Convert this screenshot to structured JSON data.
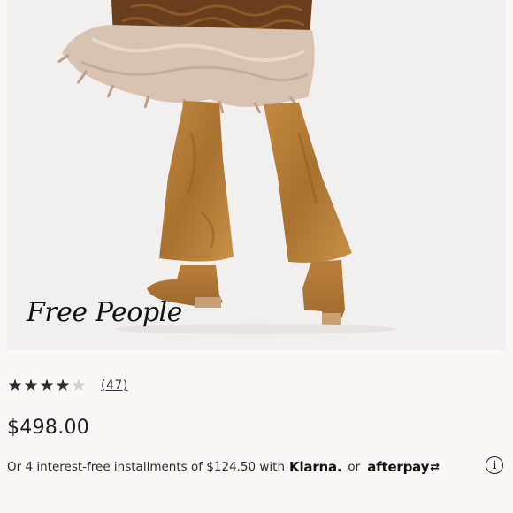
{
  "product": {
    "brand_watermark": "Free People",
    "rating": {
      "value": 4,
      "max": 5,
      "review_count_label": "(47)"
    },
    "price": "$498.00",
    "installments": {
      "prefix": "Or 4 interest-free installments of $124.50 with",
      "klarna_label": "Klarna.",
      "or_label": "or",
      "afterpay_label": "afterpay",
      "afterpay_icon": "afterpay-arrows-icon",
      "info_icon": "info-icon"
    }
  },
  "colors": {
    "background": "#fbf7f4",
    "photo_background": "#f2f0ef",
    "text": "#1f1f1f",
    "star_filled": "#2b2b2b",
    "star_empty": "#cfcfcf"
  }
}
